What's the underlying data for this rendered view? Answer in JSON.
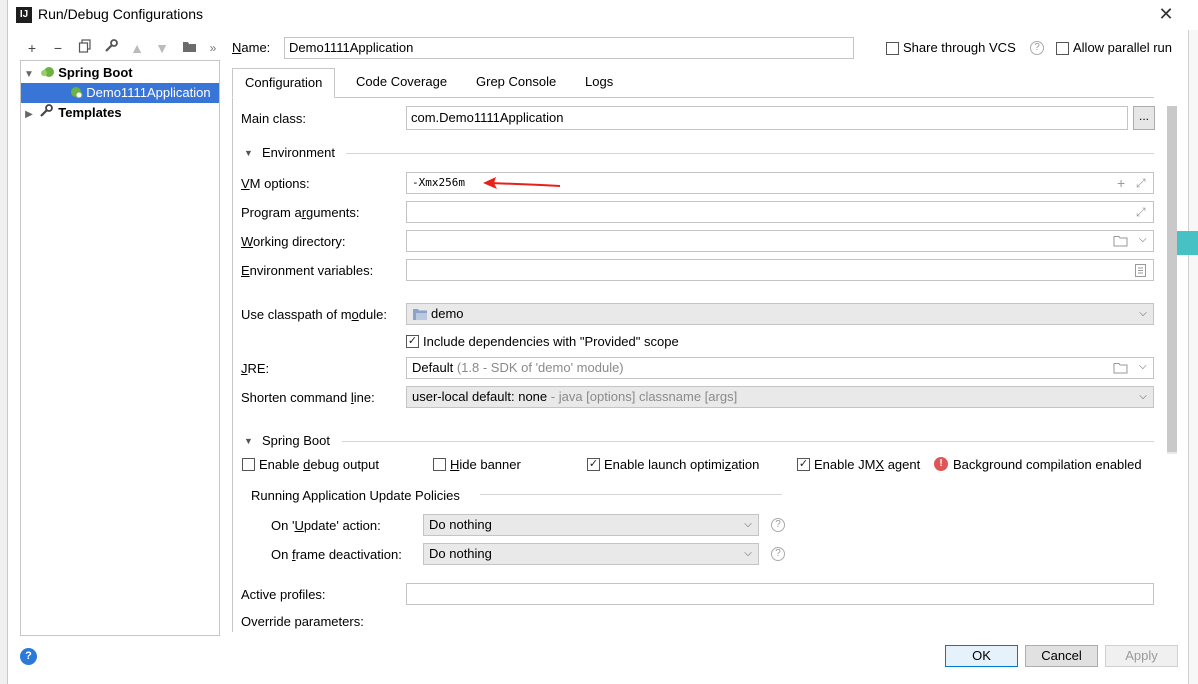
{
  "window": {
    "title": "Run/Debug Configurations"
  },
  "toolbar": {
    "add": "+",
    "remove": "−",
    "copy": "⧉",
    "edit": "🔧",
    "up": "▲",
    "down": "▼",
    "folder": "📁",
    "more": "»"
  },
  "tree": {
    "items": [
      {
        "label": "Spring Boot",
        "expanded": true
      },
      {
        "label": "Demo1111Application",
        "selected": true
      },
      {
        "label": "Templates",
        "expanded": false
      }
    ]
  },
  "header": {
    "name_label": "Name:",
    "name_value": "Demo1111Application",
    "share_vcs": "Share through VCS",
    "allow_parallel": "Allow parallel run"
  },
  "tabs": [
    {
      "label": "Configuration",
      "active": true
    },
    {
      "label": "Code Coverage"
    },
    {
      "label": "Grep Console"
    },
    {
      "label": "Logs"
    }
  ],
  "config": {
    "main_class_label": "Main class:",
    "main_class_value": "com.Demo1111Application",
    "browse": "...",
    "environment_section": "Environment",
    "vm_options_label": "VM options:",
    "vm_options_value": "-Xmx256m",
    "program_args_label": "Program arguments:",
    "working_dir_label": "Working directory:",
    "env_vars_label": "Environment variables:",
    "classpath_label": "Use classpath of module:",
    "classpath_value": "demo",
    "include_deps": "Include dependencies with \"Provided\" scope",
    "jre_label": "JRE:",
    "jre_value": "Default",
    "jre_hint": "(1.8 - SDK of 'demo' module)",
    "shorten_label": "Shorten command line:",
    "shorten_value": "user-local default: none",
    "shorten_hint": "- java [options] classname [args]",
    "spring_section": "Spring Boot",
    "enable_debug": "Enable debug output",
    "hide_banner": "Hide banner",
    "launch_opt": "Enable launch optimization",
    "jmx_agent": "Enable JMX agent",
    "bg_compile": "Background compilation enabled",
    "update_policies": "Running Application Update Policies",
    "update_action_label": "On 'Update' action:",
    "update_action_value": "Do nothing",
    "frame_deact_label": "On frame deactivation:",
    "frame_deact_value": "Do nothing",
    "active_profiles_label": "Active profiles:",
    "override_params_label": "Override parameters:"
  },
  "footer": {
    "ok": "OK",
    "cancel": "Cancel",
    "apply": "Apply",
    "help": "?"
  },
  "colors": {
    "selection": "#3875d7",
    "arrow": "#e8201a",
    "teal": "#47c1c4",
    "error": "#e05555"
  }
}
